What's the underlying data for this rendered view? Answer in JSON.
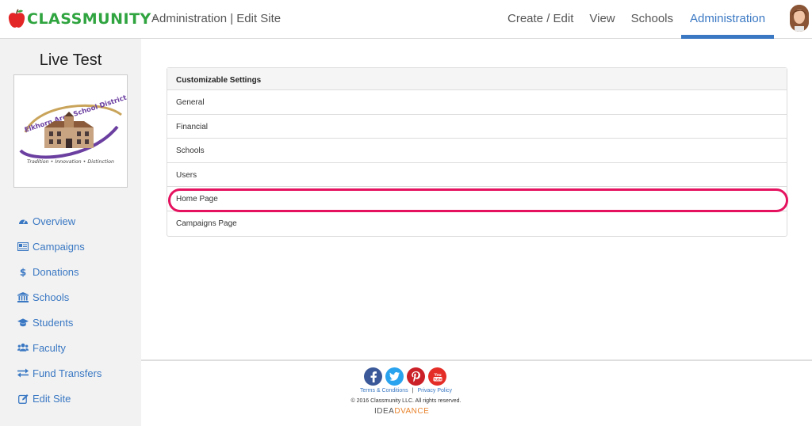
{
  "header": {
    "logo_text": "CLASSMUNITY",
    "logo_tm": "™",
    "title": "Administration | Edit Site",
    "nav": [
      {
        "label": "Create / Edit"
      },
      {
        "label": "View"
      },
      {
        "label": "Schools"
      },
      {
        "label": "Administration"
      }
    ]
  },
  "sidebar": {
    "site_name": "Live Test",
    "site_logo": {
      "name": "Elkhorn Area School District",
      "tagline": "Tradition • Innovation • Distinction"
    },
    "items": [
      {
        "label": "Overview",
        "icon": "dashboard-icon"
      },
      {
        "label": "Campaigns",
        "icon": "newspaper-icon"
      },
      {
        "label": "Donations",
        "icon": "dollar-icon"
      },
      {
        "label": "Schools",
        "icon": "institution-icon"
      },
      {
        "label": "Students",
        "icon": "graduation-cap-icon"
      },
      {
        "label": "Faculty",
        "icon": "users-icon"
      },
      {
        "label": "Fund Transfers",
        "icon": "exchange-icon"
      },
      {
        "label": "Edit Site",
        "icon": "edit-icon"
      }
    ]
  },
  "settings": {
    "header": "Customizable Settings",
    "items": [
      {
        "label": "General"
      },
      {
        "label": "Financial"
      },
      {
        "label": "Schools"
      },
      {
        "label": "Users"
      },
      {
        "label": "Home Page"
      },
      {
        "label": "Campaigns Page"
      }
    ],
    "highlighted": "Home Page"
  },
  "footer": {
    "socials": [
      {
        "name": "facebook-icon",
        "glyph": "f",
        "color": "#3b5998"
      },
      {
        "name": "twitter-icon",
        "glyph": "t",
        "color": "#2aa3ef"
      },
      {
        "name": "pinterest-icon",
        "glyph": "p",
        "color": "#cb2027"
      },
      {
        "name": "youtube-icon",
        "glyph": "You",
        "color": "#e52d27"
      }
    ],
    "terms": "Terms & Conditions",
    "separator": "|",
    "privacy": "Privacy Policy",
    "copyright": "© 2016 Classmunity LLC. All rights reserved.",
    "brand_part1": "IDEA",
    "brand_part2": "DVANCE"
  },
  "colors": {
    "accent": "#3a78c3",
    "highlight": "#e5125f",
    "logo_green": "#2fa43f"
  }
}
